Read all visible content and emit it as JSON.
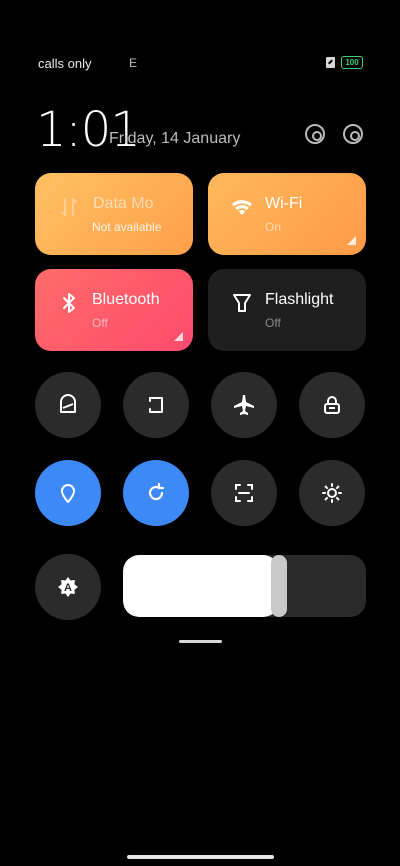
{
  "status_bar": {
    "carrier_text": "calls only",
    "network_text": "E",
    "battery_level": "100"
  },
  "header": {
    "time": "1:01",
    "date": "Friday, 14 January"
  },
  "tiles": {
    "mobile_data": {
      "title": "Data   Mo",
      "subtitle": "Not available"
    },
    "wifi": {
      "title": "Wi-Fi",
      "subtitle": "On"
    },
    "bluetooth": {
      "title": "Bluetooth",
      "subtitle": "Off"
    },
    "flashlight": {
      "title": "Flashlight",
      "subtitle": "Off"
    }
  },
  "toggles": {
    "row1": [
      "mute-icon",
      "screen-cast-icon",
      "airplane-icon",
      "lock-icon"
    ],
    "row2": [
      "location-icon",
      "auto-rotate-icon",
      "scan-icon",
      "brightness-icon"
    ]
  },
  "brightness": {
    "level_percent": 64,
    "auto_label": "A"
  },
  "colors": {
    "accent_blue": "#3d8af7",
    "mobile_data_tile": "#ffb15a",
    "wifi_tile": "#ffa94f",
    "bluetooth_tile": "#ff5a6c",
    "battery_green": "#3ecf73"
  }
}
